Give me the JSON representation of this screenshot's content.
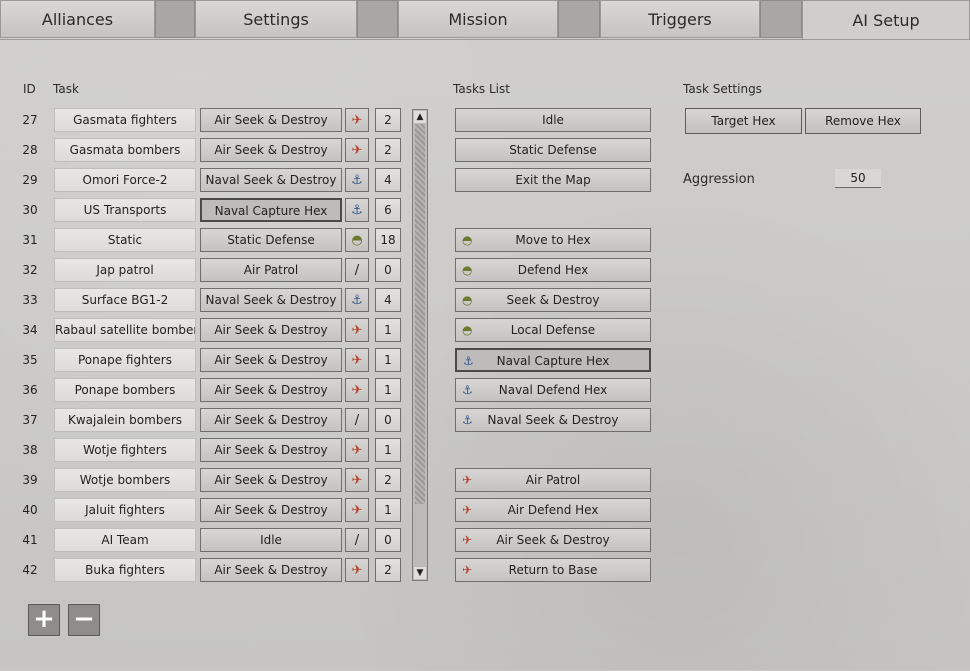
{
  "tabs": [
    {
      "label": "Alliances"
    },
    {
      "label": "Settings"
    },
    {
      "label": "Mission"
    },
    {
      "label": "Triggers"
    },
    {
      "label": "AI Setup"
    }
  ],
  "headers": {
    "id": "ID",
    "task": "Task",
    "tasks_list": "Tasks List",
    "task_settings": "Task Settings"
  },
  "rows": [
    {
      "id": "27",
      "name": "Gasmata fighters",
      "task": "Air Seek & Destroy",
      "icon": "plane-icon",
      "count": "2"
    },
    {
      "id": "28",
      "name": "Gasmata bombers",
      "task": "Air Seek & Destroy",
      "icon": "plane-icon",
      "count": "2"
    },
    {
      "id": "29",
      "name": "Omori Force-2",
      "task": "Naval Seek & Destroy",
      "icon": "anchor-icon",
      "count": "4"
    },
    {
      "id": "30",
      "name": "US Transports",
      "task": "Naval Capture Hex",
      "icon": "anchor-icon",
      "count": "6"
    },
    {
      "id": "31",
      "name": "Static",
      "task": "Static Defense",
      "icon": "helmet-icon",
      "count": "18"
    },
    {
      "id": "32",
      "name": "Jap patrol",
      "task": "Air Patrol",
      "icon": "slash-icon",
      "count": "0"
    },
    {
      "id": "33",
      "name": "Surface BG1-2",
      "task": "Naval Seek & Destroy",
      "icon": "anchor-icon",
      "count": "4"
    },
    {
      "id": "34",
      "name": "Rabaul satellite bombers",
      "task": "Air Seek & Destroy",
      "icon": "plane-icon",
      "count": "1"
    },
    {
      "id": "35",
      "name": "Ponape fighters",
      "task": "Air Seek & Destroy",
      "icon": "plane-icon",
      "count": "1"
    },
    {
      "id": "36",
      "name": "Ponape bombers",
      "task": "Air Seek & Destroy",
      "icon": "plane-icon",
      "count": "1"
    },
    {
      "id": "37",
      "name": "Kwajalein bombers",
      "task": "Air Seek & Destroy",
      "icon": "slash-icon",
      "count": "0"
    },
    {
      "id": "38",
      "name": "Wotje fighters",
      "task": "Air Seek & Destroy",
      "icon": "plane-icon",
      "count": "1"
    },
    {
      "id": "39",
      "name": "Wotje bombers",
      "task": "Air Seek & Destroy",
      "icon": "plane-icon",
      "count": "2"
    },
    {
      "id": "40",
      "name": "Jaluit fighters",
      "task": "Air Seek & Destroy",
      "icon": "plane-icon",
      "count": "1"
    },
    {
      "id": "41",
      "name": "AI Team",
      "task": "Idle",
      "icon": "slash-icon",
      "count": "0"
    },
    {
      "id": "42",
      "name": "Buka fighters",
      "task": "Air Seek & Destroy",
      "icon": "plane-icon",
      "count": "2"
    }
  ],
  "tasks_list": [
    {
      "label": "Idle",
      "icon": ""
    },
    {
      "label": "Static Defense",
      "icon": ""
    },
    {
      "label": "Exit the Map",
      "icon": ""
    },
    {
      "label": "Move to Hex",
      "icon": "helmet-icon"
    },
    {
      "label": "Defend Hex",
      "icon": "helmet-icon"
    },
    {
      "label": "Seek & Destroy",
      "icon": "helmet-icon"
    },
    {
      "label": "Local Defense",
      "icon": "helmet-icon"
    },
    {
      "label": "Naval Capture Hex",
      "icon": "anchor-icon"
    },
    {
      "label": "Naval Defend Hex",
      "icon": "anchor-icon"
    },
    {
      "label": "Naval Seek & Destroy",
      "icon": "anchor-icon"
    },
    {
      "label": "Air Patrol",
      "icon": "plane-icon"
    },
    {
      "label": "Air Defend Hex",
      "icon": "plane-icon"
    },
    {
      "label": "Air Seek & Destroy",
      "icon": "plane-icon"
    },
    {
      "label": "Return to Base",
      "icon": "plane-icon"
    }
  ],
  "task_settings": {
    "target_hex_label": "Target Hex",
    "remove_hex_label": "Remove Hex",
    "aggression_label": "Aggression",
    "aggression_value": "50"
  },
  "controls": {
    "add_label": "+",
    "remove_label": "−",
    "scroll_up": "▲",
    "scroll_down": "▼"
  }
}
